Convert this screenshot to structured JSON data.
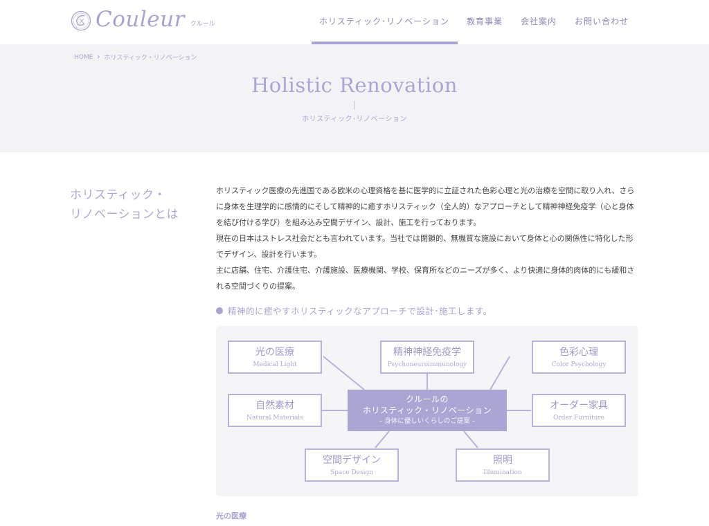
{
  "header": {
    "logo_text": "Couleur",
    "logo_sub": "クルール",
    "nav": [
      {
        "label": "ホリスティック･リノベーション",
        "active": true
      },
      {
        "label": "教育事業",
        "active": false
      },
      {
        "label": "会社案内",
        "active": false
      },
      {
        "label": "お問い合わせ",
        "active": false
      }
    ]
  },
  "banner": {
    "breadcrumb": {
      "home": "HOME",
      "current": "ホリスティック・リノベーション"
    },
    "title": "Holistic Renovation",
    "subtitle": "ホリスティック･リノベーション"
  },
  "section": {
    "title_line1": "ホリスティック・",
    "title_line2": "リノベーションとは",
    "paragraphs": [
      "ホリスティック医療の先進国である欧米の心理資格を基に医学的に立証された色彩心理と光の治療を空間に取り入れ、さらに身体を生理学的に感情的にそして精神的に癒すホリスティック（全人的）なアプローチとして精神神経免疫学（心と身体を結び付ける学び）を組み込み空間デザイン、設計、施工を行っております。",
      "現在の日本はストレス社会だとも言われています。当社では閉鎖的、無機質な施設において身体と心の関係性に特化した形でデザイン、設計を行います。",
      "主に店舗、住宅、介護住宅、介護施設、医療機関、学校、保育所などのニーズが多く、より快適に身体的肉体的にも緩和される空間づくりの提案。"
    ],
    "sub_heading": "精神的に癒やすホリスティックなアプローチで設計･施工します。",
    "bottom_heading": "光の医療"
  },
  "diagram": {
    "center": {
      "line1": "クルールの",
      "line2": "ホリスティック・リノベーション",
      "sub": "– 身体に優しいくらしのご提案 –"
    },
    "nodes": {
      "medical_light": {
        "jp": "光の医療",
        "en": "Medical Light"
      },
      "psycho": {
        "jp": "精神神経免疫学",
        "en": "Psychoneuroimmunology"
      },
      "color": {
        "jp": "色彩心理",
        "en": "Color Psychology"
      },
      "natural": {
        "jp": "自然素材",
        "en": "Natural Materials"
      },
      "furniture": {
        "jp": "オーダー家具",
        "en": "Order Furniture"
      },
      "space": {
        "jp": "空間デザイン",
        "en": "Space Design"
      },
      "illumination": {
        "jp": "照明",
        "en": "Illumination"
      }
    }
  },
  "colors": {
    "accent": "#a7a3d2",
    "banner_bg": "#f3f3f6",
    "diagram_bg": "#f5f5f8",
    "text": "#444444"
  }
}
